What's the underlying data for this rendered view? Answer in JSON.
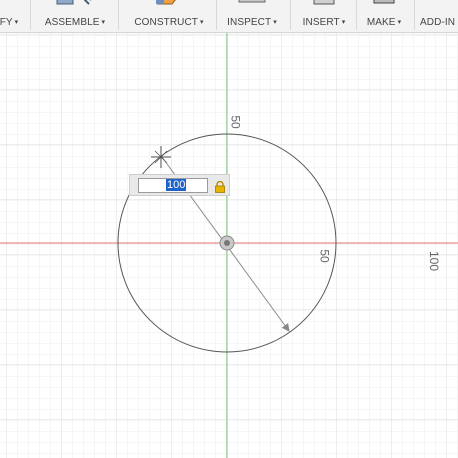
{
  "toolbar": {
    "items": [
      {
        "label": "FY"
      },
      {
        "label": "ASSEMBLE"
      },
      {
        "label": "CONSTRUCT"
      },
      {
        "label": "INSPECT"
      },
      {
        "label": "INSERT"
      },
      {
        "label": "MAKE"
      },
      {
        "label": "ADD-IN"
      }
    ],
    "caret": "▾"
  },
  "sketch": {
    "dimension_input_value": "100",
    "labels": {
      "vertical_axis_50": "50",
      "circle_right_50": "50",
      "horizontal_axis_100": "100"
    }
  },
  "colors": {
    "x_axis": "#e06a6a",
    "y_axis": "#7ad07a",
    "grid_minor": "#ececec",
    "grid_major": "#dcdcdc",
    "geometry": "#555555",
    "dimension": "#888888",
    "lock": "#e0a800"
  }
}
